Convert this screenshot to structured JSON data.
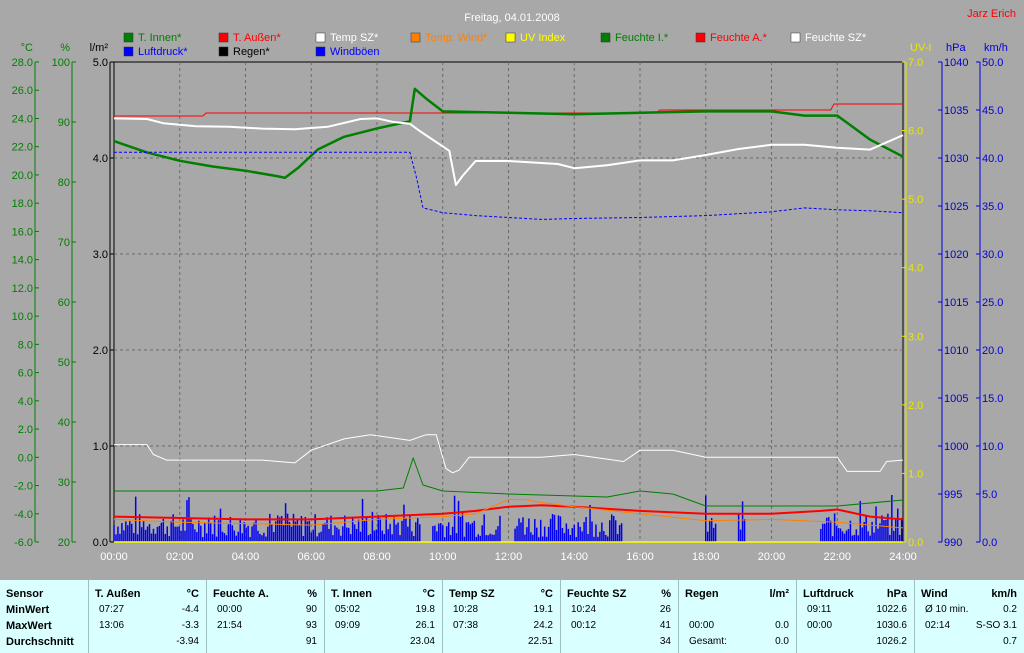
{
  "chart_data": {
    "type": "line",
    "title": "Freitag, 04.01.2008",
    "author": "Jarz Erich",
    "x_ticks": [
      "00:00",
      "02:00",
      "04:00",
      "06:00",
      "08:00",
      "10:00",
      "12:00",
      "14:00",
      "16:00",
      "18:00",
      "20:00",
      "22:00",
      "24:00"
    ],
    "x_range_hours": [
      0,
      24
    ],
    "grid": true,
    "axes": {
      "temp": {
        "unit": "°C",
        "range": [
          -6,
          28
        ],
        "ticks": [
          "28.0",
          "26.0",
          "24.0",
          "22.0",
          "20.0",
          "18.0",
          "16.0",
          "14.0",
          "12.0",
          "10.0",
          "8.0",
          "6.0",
          "4.0",
          "2.0",
          "0.0",
          "-2.0",
          "-4.0",
          "-6.0"
        ],
        "color": "#007f00"
      },
      "humidity": {
        "unit": "%",
        "range": [
          20,
          100
        ],
        "ticks": [
          "100",
          "90",
          "80",
          "70",
          "60",
          "50",
          "40",
          "30",
          "20"
        ],
        "color": "#007f00"
      },
      "rain": {
        "unit": "l/m²",
        "range": [
          0,
          5
        ],
        "ticks": [
          "5.0",
          "4.0",
          "3.0",
          "2.0",
          "1.0",
          "0.0"
        ],
        "color": "#000000"
      },
      "uv": {
        "unit": "UV-I",
        "range": [
          0,
          7
        ],
        "ticks": [
          "7.0",
          "6.0",
          "5.0",
          "4.0",
          "3.0",
          "2.0",
          "1.0",
          "0.0"
        ],
        "color": "#e8e800"
      },
      "pressure": {
        "unit": "hPa",
        "range": [
          990,
          1040
        ],
        "ticks": [
          "1040",
          "1035",
          "1030",
          "1025",
          "1020",
          "1015",
          "1010",
          "1005",
          "1000",
          "995",
          "990"
        ],
        "color": "#0000dd"
      },
      "wind": {
        "unit": "km/h",
        "range": [
          0,
          50
        ],
        "ticks": [
          "50.0",
          "45.0",
          "40.0",
          "35.0",
          "30.0",
          "25.0",
          "20.0",
          "15.0",
          "10.0",
          "5.0",
          "0.0"
        ],
        "color": "#0000dd"
      }
    },
    "legend": [
      {
        "name": "T. Innen*",
        "color": "#007f00"
      },
      {
        "name": "T. Außen*",
        "color": "#ff0000"
      },
      {
        "name": "Temp SZ*",
        "color": "#ffffff"
      },
      {
        "name": "Temp. Wind*",
        "color": "#ff8000"
      },
      {
        "name": "UV Index",
        "color": "#ffff00"
      },
      {
        "name": "Feuchte I.*",
        "color": "#007f00"
      },
      {
        "name": "Feuchte A.*",
        "color": "#ff0000"
      },
      {
        "name": "Feuchte SZ*",
        "color": "#ffffff"
      },
      {
        "name": "Luftdruck*",
        "color": "#0000ff"
      },
      {
        "name": "Regen*",
        "color": "#000000"
      },
      {
        "name": "Windböen",
        "color": "#0000ff"
      }
    ],
    "series": [
      {
        "name": "Feuchte A.*",
        "axis": "humidity",
        "color": "#ff0000",
        "width": 1,
        "points": [
          [
            0,
            91
          ],
          [
            2.7,
            91
          ],
          [
            2.8,
            91.5
          ],
          [
            16.5,
            91.5
          ],
          [
            16.6,
            92
          ],
          [
            21.8,
            92
          ],
          [
            21.9,
            93
          ],
          [
            24,
            93
          ]
        ]
      },
      {
        "name": "T. Innen*",
        "axis": "temp",
        "color": "#007f00",
        "width": 2.5,
        "points": [
          [
            0,
            22.4
          ],
          [
            1,
            21.6
          ],
          [
            2,
            21
          ],
          [
            3,
            20.6
          ],
          [
            4,
            20.3
          ],
          [
            5,
            19.9
          ],
          [
            5.2,
            19.8
          ],
          [
            5.6,
            20.5
          ],
          [
            6.2,
            21.8
          ],
          [
            7,
            22.7
          ],
          [
            8,
            23.3
          ],
          [
            9,
            23.8
          ],
          [
            9.15,
            26.1
          ],
          [
            9.5,
            25.4
          ],
          [
            10,
            24.5
          ],
          [
            12,
            24.4
          ],
          [
            14,
            24.3
          ],
          [
            16,
            24.4
          ],
          [
            18,
            24.5
          ],
          [
            19,
            24.5
          ],
          [
            20,
            24.5
          ],
          [
            21,
            24.2
          ],
          [
            22,
            24.2
          ],
          [
            23,
            22.5
          ],
          [
            24,
            21.3
          ]
        ]
      },
      {
        "name": "Feuchte SZ*",
        "axis": "humidity",
        "color": "#ffffff",
        "width": 2,
        "points": [
          [
            0,
            90.6
          ],
          [
            1,
            90.5
          ],
          [
            1.5,
            89.8
          ],
          [
            2.5,
            89.3
          ],
          [
            3.5,
            89.2
          ],
          [
            4.5,
            88.9
          ],
          [
            5.5,
            88.8
          ],
          [
            6.5,
            89.2
          ],
          [
            7.5,
            90.5
          ],
          [
            8,
            90.6
          ],
          [
            8.5,
            90
          ],
          [
            9,
            89.7
          ],
          [
            9.3,
            88.5
          ],
          [
            10.2,
            85.2
          ],
          [
            10.4,
            79.5
          ],
          [
            10.6,
            81
          ],
          [
            11,
            83.5
          ],
          [
            12,
            83.5
          ],
          [
            13.5,
            83
          ],
          [
            14,
            82.3
          ],
          [
            15,
            82.8
          ],
          [
            16,
            83.6
          ],
          [
            17,
            83.6
          ],
          [
            18,
            84.5
          ],
          [
            19,
            85.5
          ],
          [
            20,
            86.2
          ],
          [
            21,
            86.2
          ],
          [
            22,
            85.7
          ],
          [
            23,
            85.4
          ],
          [
            24,
            87.8
          ]
        ]
      },
      {
        "name": "Luftdruck*",
        "axis": "pressure",
        "color": "#0000ff",
        "width": 1,
        "dashed": true,
        "points": [
          [
            0,
            1030.6
          ],
          [
            9,
            1030.6
          ],
          [
            9.2,
            1028
          ],
          [
            9.4,
            1024.8
          ],
          [
            10,
            1024.3
          ],
          [
            11,
            1024
          ],
          [
            12,
            1023.8
          ],
          [
            13,
            1023.6
          ],
          [
            14,
            1023.7
          ],
          [
            16,
            1023.8
          ],
          [
            18,
            1024
          ],
          [
            19,
            1024.2
          ],
          [
            20,
            1024.4
          ],
          [
            21,
            1024.8
          ],
          [
            22,
            1024.6
          ],
          [
            23,
            1024.5
          ],
          [
            24,
            1024.3
          ]
        ]
      },
      {
        "name": "Temp SZ*",
        "axis": "temp",
        "color": "#ffffff",
        "width": 1,
        "points": [
          [
            0,
            0.9
          ],
          [
            1,
            0.9
          ],
          [
            1.2,
            0.2
          ],
          [
            1.6,
            -0.2
          ],
          [
            4.5,
            -0.2
          ],
          [
            5.5,
            -0.4
          ],
          [
            6,
            0.5
          ],
          [
            7,
            1.3
          ],
          [
            7.8,
            1.6
          ],
          [
            9,
            1.2
          ],
          [
            9.5,
            1.6
          ],
          [
            9.8,
            1.6
          ],
          [
            10.1,
            -0.8
          ],
          [
            10.3,
            -1.1
          ],
          [
            10.5,
            -0.9
          ],
          [
            10.8,
            0
          ],
          [
            13,
            0
          ],
          [
            14,
            0.2
          ],
          [
            15.5,
            -0.3
          ],
          [
            16,
            0.5
          ],
          [
            17,
            0.5
          ],
          [
            18,
            0
          ],
          [
            22,
            0
          ],
          [
            22.3,
            -1
          ],
          [
            23.3,
            -1
          ],
          [
            23.5,
            -0.3
          ],
          [
            24,
            -0.2
          ]
        ]
      },
      {
        "name": "T. Außen*",
        "axis": "temp",
        "color": "#ff0000",
        "width": 2,
        "points": [
          [
            0,
            -4.2
          ],
          [
            2,
            -4.3
          ],
          [
            4,
            -4.4
          ],
          [
            6,
            -4.4
          ],
          [
            8,
            -4.2
          ],
          [
            10,
            -4
          ],
          [
            11,
            -3.8
          ],
          [
            12,
            -3.5
          ],
          [
            13,
            -3.4
          ],
          [
            14,
            -3.5
          ],
          [
            16,
            -3.8
          ],
          [
            18,
            -4
          ],
          [
            20,
            -4
          ],
          [
            21.5,
            -3.8
          ],
          [
            22,
            -3.7
          ],
          [
            23,
            -4.2
          ],
          [
            24,
            -4.4
          ]
        ]
      },
      {
        "name": "Temp. Wind*",
        "axis": "temp",
        "color": "#ff8000",
        "width": 1,
        "points": [
          [
            0,
            -4.4
          ],
          [
            2,
            -4.6
          ],
          [
            4,
            -4.7
          ],
          [
            6,
            -4.8
          ],
          [
            8,
            -4.4
          ],
          [
            10,
            -4.2
          ],
          [
            11,
            -4
          ],
          [
            12,
            -3
          ],
          [
            12.5,
            -3
          ],
          [
            13,
            -3.2
          ],
          [
            14,
            -3.5
          ],
          [
            16,
            -4
          ],
          [
            18,
            -4.5
          ],
          [
            20,
            -4.4
          ],
          [
            22,
            -4.6
          ],
          [
            23,
            -4.8
          ],
          [
            24,
            -5
          ]
        ]
      },
      {
        "name": "Feuchte I.*",
        "axis": "humidity",
        "color": "#007f00",
        "width": 1,
        "points": [
          [
            0,
            28.5
          ],
          [
            7,
            28.5
          ],
          [
            8,
            28.5
          ],
          [
            8.8,
            29
          ],
          [
            9.1,
            34
          ],
          [
            9.4,
            29.5
          ],
          [
            10,
            28.5
          ],
          [
            12,
            28
          ],
          [
            15,
            27.5
          ],
          [
            16,
            28.5
          ],
          [
            17,
            28
          ],
          [
            18,
            26
          ],
          [
            22,
            26
          ],
          [
            24,
            27
          ]
        ]
      },
      {
        "name": "UV Index",
        "axis": "uv",
        "color": "#ffff00",
        "width": 1.5,
        "points": [
          [
            0,
            0
          ],
          [
            24,
            0
          ]
        ]
      }
    ],
    "summary_table": {
      "row_labels": [
        "Sensor",
        "MinWert",
        "MaxWert",
        "Durchschnitt"
      ],
      "columns": [
        {
          "name": "T. Außen",
          "unit": "°C",
          "rows": [
            [
              "07:27",
              "-4.4"
            ],
            [
              "13:06",
              "-3.3"
            ],
            [
              "",
              "-3.94"
            ]
          ]
        },
        {
          "name": "Feuchte A.",
          "unit": "%",
          "rows": [
            [
              "00:00",
              "90"
            ],
            [
              "21:54",
              "93"
            ],
            [
              "",
              "91"
            ]
          ]
        },
        {
          "name": "T. Innen",
          "unit": "°C",
          "rows": [
            [
              "05:02",
              "19.8"
            ],
            [
              "09:09",
              "26.1"
            ],
            [
              "",
              "23.04"
            ]
          ]
        },
        {
          "name": "Temp SZ",
          "unit": "°C",
          "rows": [
            [
              "10:28",
              "19.1"
            ],
            [
              "07:38",
              "24.2"
            ],
            [
              "",
              "22.51"
            ]
          ]
        },
        {
          "name": "Feuchte SZ",
          "unit": "%",
          "rows": [
            [
              "10:24",
              "26"
            ],
            [
              "00:12",
              "41"
            ],
            [
              "",
              "34"
            ]
          ]
        },
        {
          "name": "Regen",
          "unit": "l/m²",
          "rows": [
            [
              "",
              ""
            ],
            [
              "00:00",
              "0.0"
            ],
            [
              "Gesamt:",
              "0.0"
            ]
          ]
        },
        {
          "name": "Luftdruck",
          "unit": "hPa",
          "rows": [
            [
              "09:11",
              "1022.6"
            ],
            [
              "00:00",
              "1030.6"
            ],
            [
              "",
              "1026.2"
            ]
          ]
        },
        {
          "name": "Wind",
          "unit": "km/h",
          "rows": [
            [
              "Ø 10 min.",
              "0.2"
            ],
            [
              "02:14",
              "S-SO 3.1"
            ],
            [
              "",
              "0.7"
            ]
          ]
        }
      ]
    }
  }
}
